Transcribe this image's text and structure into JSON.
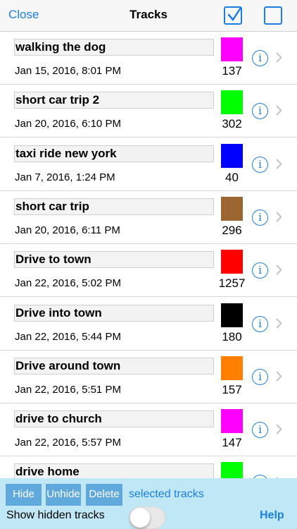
{
  "nav": {
    "close_label": "Close",
    "title": "Tracks",
    "select_all_icon": "checked-checkbox-icon",
    "deselect_all_icon": "unchecked-checkbox-icon"
  },
  "tracks": [
    {
      "name": "walking the dog",
      "date": "Jan 15, 2016, 8:01 PM",
      "color": "#ff00ff",
      "count": "137"
    },
    {
      "name": "short car trip 2",
      "date": "Jan 20, 2016, 6:10 PM",
      "color": "#00ff00",
      "count": "302"
    },
    {
      "name": "taxi ride new york",
      "date": "Jan 7, 2016, 1:24 PM",
      "color": "#0000ff",
      "count": "40"
    },
    {
      "name": "short car trip",
      "date": "Jan 20, 2016, 6:11 PM",
      "color": "#9c6633",
      "count": "296"
    },
    {
      "name": "Drive to town",
      "date": "Jan 22, 2016, 5:02 PM",
      "color": "#ff0000",
      "count": "1257"
    },
    {
      "name": "Drive into town",
      "date": "Jan 22, 2016, 5:44 PM",
      "color": "#000000",
      "count": "180"
    },
    {
      "name": "Drive around town",
      "date": "Jan 22, 2016, 5:51 PM",
      "color": "#ff8000",
      "count": "157"
    },
    {
      "name": "drive to church",
      "date": "Jan 22, 2016, 5:57 PM",
      "color": "#ff00ff",
      "count": "147"
    },
    {
      "name": "drive home",
      "date": "",
      "color": "#00ff00",
      "count": ""
    }
  ],
  "toolbar": {
    "hide_label": "Hide",
    "unhide_label": "Unhide",
    "delete_label": "Delete",
    "selected_label": "selected tracks",
    "show_hidden_label": "Show hidden tracks",
    "show_hidden_on": false,
    "help_label": "Help"
  },
  "colors": {
    "accent": "#1a7fe0",
    "toolbar_bg": "#bfe7f6",
    "button_bg": "#5fa9dc"
  }
}
